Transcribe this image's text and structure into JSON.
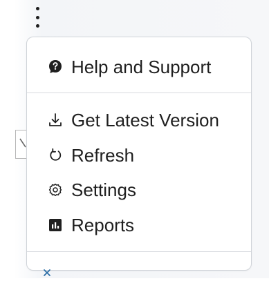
{
  "menu": {
    "items": [
      {
        "label": "Help and Support",
        "icon": "help-bubble-icon"
      },
      {
        "label": "Get Latest Version",
        "icon": "download-icon"
      },
      {
        "label": "Refresh",
        "icon": "refresh-icon"
      },
      {
        "label": "Settings",
        "icon": "settings-gear-icon"
      },
      {
        "label": "Reports",
        "icon": "reports-chart-icon"
      }
    ]
  },
  "colors": {
    "text": "#1f1f1f",
    "border": "#cfd3d8",
    "accent": "#2b6ea6"
  },
  "controls": {
    "more_menu_icon": "vertical-ellipsis-icon",
    "edge_tab_icon": "pen-icon",
    "close_icon": "close-icon"
  }
}
